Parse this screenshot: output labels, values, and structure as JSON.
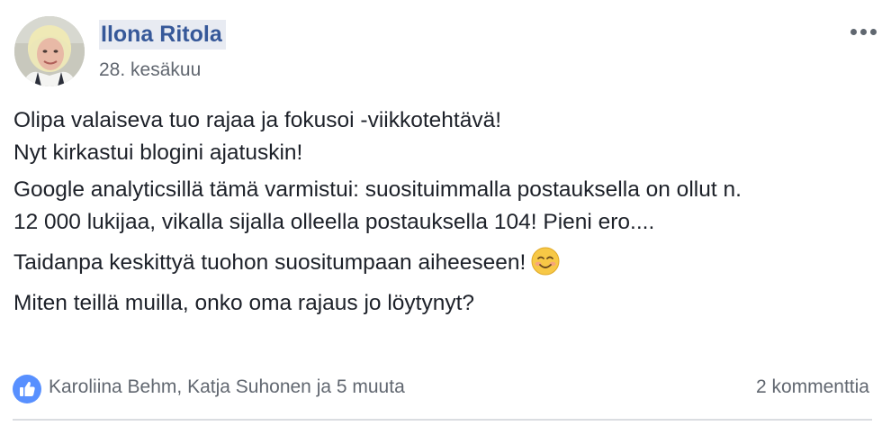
{
  "post": {
    "author_name": "Ilona Ritola",
    "date": "28. kesäkuu",
    "more_icon": "ellipsis-icon",
    "avatar_icon": "profile-photo",
    "paragraphs": [
      {
        "line1": "Olipa valaiseva tuo rajaa ja fokusoi -viikkotehtävä!",
        "line2": "Nyt kirkastui blogini ajatuskin!"
      },
      {
        "line1": "Google analyticsillä tämä varmistui: suosituimmalla postauksella on ollut n.",
        "line2": "12 000 lukijaa, vikalla sijalla olleella postauksella 104! Pieni ero...."
      },
      {
        "text": "Taidanpa keskittyä tuohon suositumpaan aiheeseen!",
        "emoji": "smiling-face-emoji"
      },
      {
        "text": "Miten teillä muilla, onko oma rajaus jo löytynyt?"
      }
    ]
  },
  "footer": {
    "like_icon": "thumbs-up-icon",
    "reactions_text": "Karoliina Behm, Katja Suhonen ja 5 muuta",
    "comments_text": "2 kommenttia"
  },
  "colors": {
    "author_link": "#365899",
    "secondary_text": "#616770",
    "like_blue": "#5890ff",
    "emoji_yellow": "#f7c846"
  }
}
